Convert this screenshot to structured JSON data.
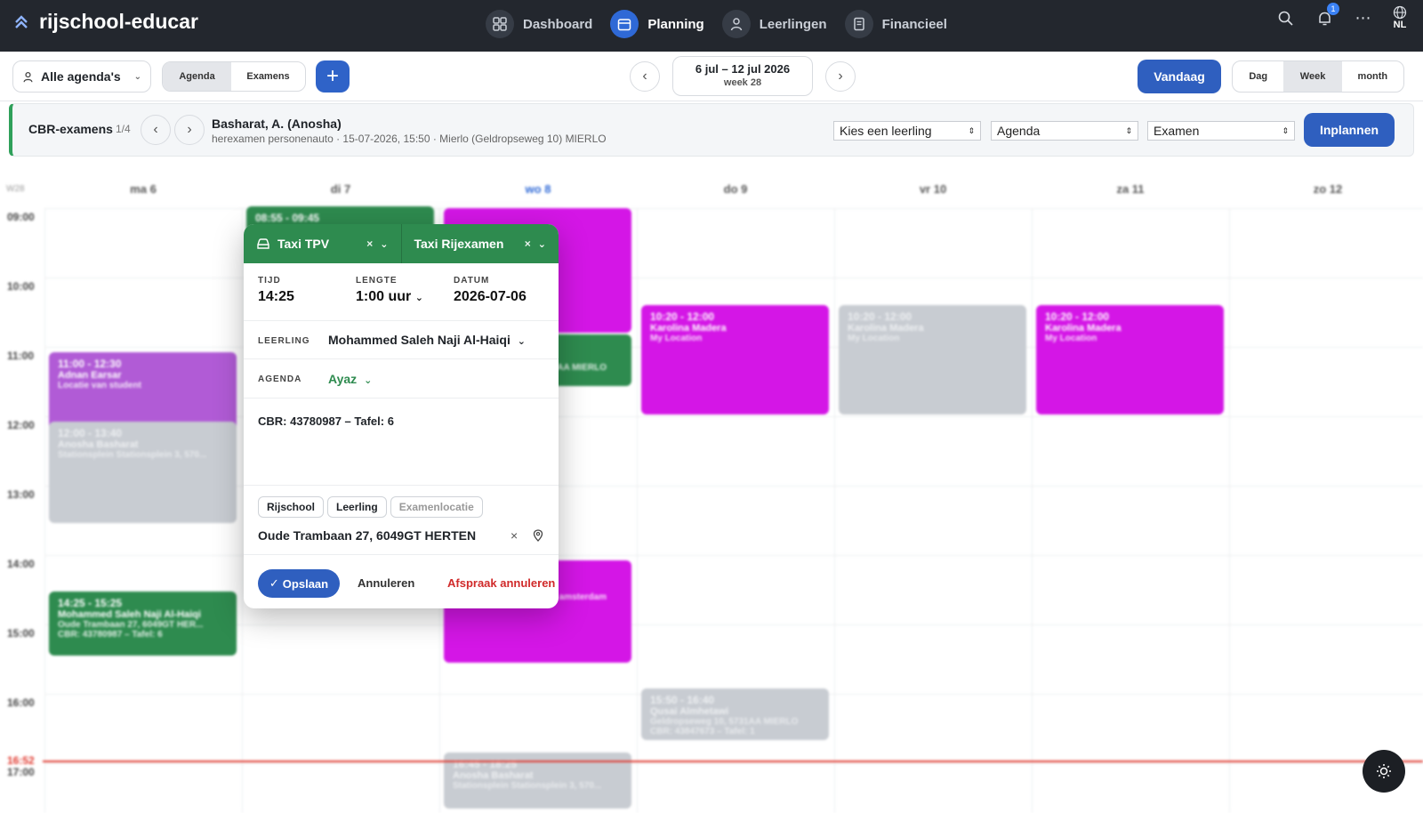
{
  "header": {
    "brand": "rijschool-educar",
    "nav": [
      {
        "label": "Dashboard",
        "icon": "dashboard-icon"
      },
      {
        "label": "Planning",
        "icon": "calendar-icon",
        "active": true
      },
      {
        "label": "Leerlingen",
        "icon": "person-icon"
      },
      {
        "label": "Financieel",
        "icon": "receipt-icon"
      }
    ],
    "notifications": "1",
    "lang": "NL"
  },
  "toolbar": {
    "agenda_select": "Alle agenda's",
    "tabs": [
      "Agenda",
      "Examens"
    ],
    "date_range": "6 jul – 12 jul 2026",
    "week": "week 28",
    "today": "Vandaag",
    "views": [
      "Dag",
      "Week",
      "month"
    ]
  },
  "cbr": {
    "title": "CBR-examens",
    "count": "1/4",
    "name": "Basharat, A. (Anosha)",
    "details": "herexamen personenauto · 15-07-2026, 15:50 · Mierlo (Geldropseweg 10) MIERLO",
    "selects": [
      "Kies een leerling",
      "Agenda",
      "Examen"
    ],
    "button": "Inplannen"
  },
  "calendar": {
    "week_label": "W28",
    "days": [
      "ma 6",
      "di 7",
      "wo 8",
      "do 9",
      "vr 10",
      "za 11",
      "zo 12"
    ],
    "hours": [
      "09:00",
      "10:00",
      "11:00",
      "12:00",
      "13:00",
      "14:00",
      "15:00",
      "16:00",
      "17:00"
    ],
    "now": "16:52",
    "events": [
      {
        "time": "11:00 - 12:30",
        "name": "Adnan Earsar",
        "loc": "Locatie van student"
      },
      {
        "time": "12:00 - 13:40",
        "name": "Anosha Basharat",
        "loc": "Stationsplein Stationsplein 3, 570..."
      },
      {
        "time": "14:25 - 15:25",
        "name": "Mohammed Saleh Naji Al-Haiqi",
        "loc": "Oude Trambaan 27, 6049GT HER...",
        "note": "CBR: 43780987 – Tafel: 6"
      },
      {
        "time": "08:55 - 09:45",
        "name": "",
        "loc": ""
      },
      {
        "time": "10:20 - 12:00",
        "name": "Karolina Madera",
        "loc": "My Location"
      },
      {
        "time": "10:20 - 12:00",
        "name": "Karolina Madera",
        "loc": "My Location"
      },
      {
        "time": "10:20 - 12:00",
        "name": "Karolina Madera",
        "loc": "My Location"
      },
      {
        "time": "15:50 - 16:40",
        "name": "Qusai Almhetawi",
        "loc": "Geldropseweg 10, 5731AA MIERLO",
        "note": "CBR: 43847673 – Tafel: 1"
      },
      {
        "time": "16:45 - 18:25",
        "name": "Anosha Basharat",
        "loc": "Stationsplein Stationsplein 3, 570..."
      },
      {
        "time": "",
        "name": "",
        "loc": "31AA MIERLO"
      },
      {
        "time": "",
        "name": "",
        "loc": "Z amsterdam"
      }
    ]
  },
  "modal": {
    "type_left": "Taxi TPV",
    "type_right": "Taxi Rijexamen",
    "tijd_label": "TIJD",
    "tijd": "14:25",
    "lengte_label": "LENGTE",
    "lengte": "1:00 uur",
    "datum_label": "DATUM",
    "datum": "2026-07-06",
    "leerling_label": "LEERLING",
    "leerling": "Mohammed Saleh Naji Al-Haiqi",
    "agenda_label": "AGENDA",
    "agenda": "Ayaz",
    "note": "CBR: 43780987 – Tafel: 6",
    "chips": [
      "Rijschool",
      "Leerling",
      "Examenlocatie"
    ],
    "address": "Oude Trambaan 27, 6049GT HERTEN",
    "save": "Opslaan",
    "cancel": "Annuleren",
    "cancel_appointment": "Afspraak annuleren"
  },
  "colors": {
    "green": "#2e8b4f",
    "blue": "#2f5fbf",
    "pink": "#d416e6",
    "topbar": "#23272e"
  }
}
